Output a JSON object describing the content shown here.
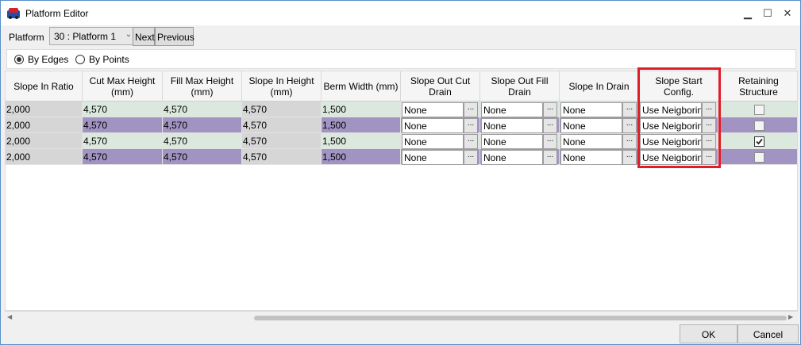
{
  "window": {
    "title": "Platform Editor",
    "controls": {
      "minimize": "▁",
      "maximize": "☐",
      "close": "✕"
    }
  },
  "toolbar": {
    "platform_label": "Platform",
    "platform_value": "30 : Platform 1",
    "next_label": "Next",
    "previous_label": "Previous"
  },
  "mode": {
    "by_edges_label": "By Edges",
    "by_points_label": "By Points",
    "selected": "By Edges"
  },
  "grid": {
    "columns": [
      "Slope In Ratio",
      "Cut Max Height (mm)",
      "Fill Max Height (mm)",
      "Slope In Height (mm)",
      "Berm Width (mm)",
      "Slope Out Cut Drain",
      "Slope Out Fill Drain",
      "Slope In Drain",
      "Slope Start Config.",
      "Retaining Structure"
    ],
    "rows": [
      {
        "slope_in_ratio": "2,000",
        "cut_max_height": "4,570",
        "fill_max_height": "4,570",
        "slope_in_height": "4,570",
        "berm_width": "1,500",
        "slope_out_cut_drain": "None",
        "slope_out_fill_drain": "None",
        "slope_in_drain": "None",
        "slope_start_config": "Use Neigborin",
        "retaining_structure": false,
        "ellipsis": "..."
      },
      {
        "slope_in_ratio": "2,000",
        "cut_max_height": "4,570",
        "fill_max_height": "4,570",
        "slope_in_height": "4,570",
        "berm_width": "1,500",
        "slope_out_cut_drain": "None",
        "slope_out_fill_drain": "None",
        "slope_in_drain": "None",
        "slope_start_config": "Use Neigborin",
        "retaining_structure": false,
        "ellipsis": "..."
      },
      {
        "slope_in_ratio": "2,000",
        "cut_max_height": "4,570",
        "fill_max_height": "4,570",
        "slope_in_height": "4,570",
        "berm_width": "1,500",
        "slope_out_cut_drain": "None",
        "slope_out_fill_drain": "None",
        "slope_in_drain": "None",
        "slope_start_config": "Use Neigborin",
        "retaining_structure": true,
        "ellipsis": "..."
      },
      {
        "slope_in_ratio": "2,000",
        "cut_max_height": "4,570",
        "fill_max_height": "4,570",
        "slope_in_height": "4,570",
        "berm_width": "1,500",
        "slope_out_cut_drain": "None",
        "slope_out_fill_drain": "None",
        "slope_in_drain": "None",
        "slope_start_config": "Use Neigborin",
        "retaining_structure": false,
        "ellipsis": "..."
      }
    ]
  },
  "footer": {
    "ok_label": "OK",
    "cancel_label": "Cancel"
  },
  "colors": {
    "row_green": "#dbe8dd",
    "row_purple": "#a294c2",
    "highlight": "#e11d2a"
  }
}
